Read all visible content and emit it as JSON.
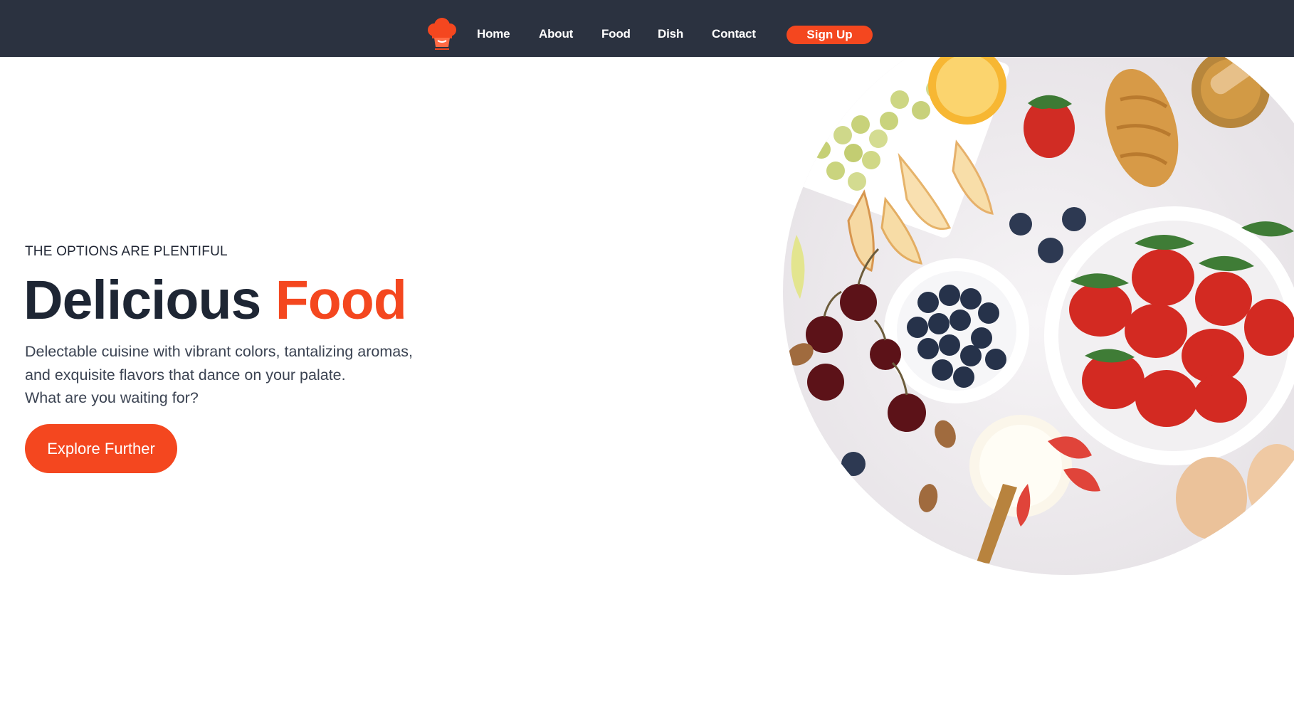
{
  "nav": {
    "logo_icon": "chef-hat-icon",
    "links": [
      "Home",
      "About",
      "Food",
      "Dish",
      "Contact"
    ],
    "signup_label": "Sign Up"
  },
  "hero": {
    "eyebrow": "THE OPTIONS ARE PLENTIFUL",
    "headline_main": "Delicious",
    "headline_accent": "Food",
    "description_lines": [
      "Delectable cuisine with vibrant colors, tantalizing aromas,",
      "and exquisite flavors that dance on your palate.",
      "What are you waiting for?"
    ],
    "cta_label": "Explore Further"
  },
  "colors": {
    "nav_background": "#2b3240",
    "accent": "#f4471f",
    "heading": "#1e2634",
    "body_text": "#3b4352"
  }
}
